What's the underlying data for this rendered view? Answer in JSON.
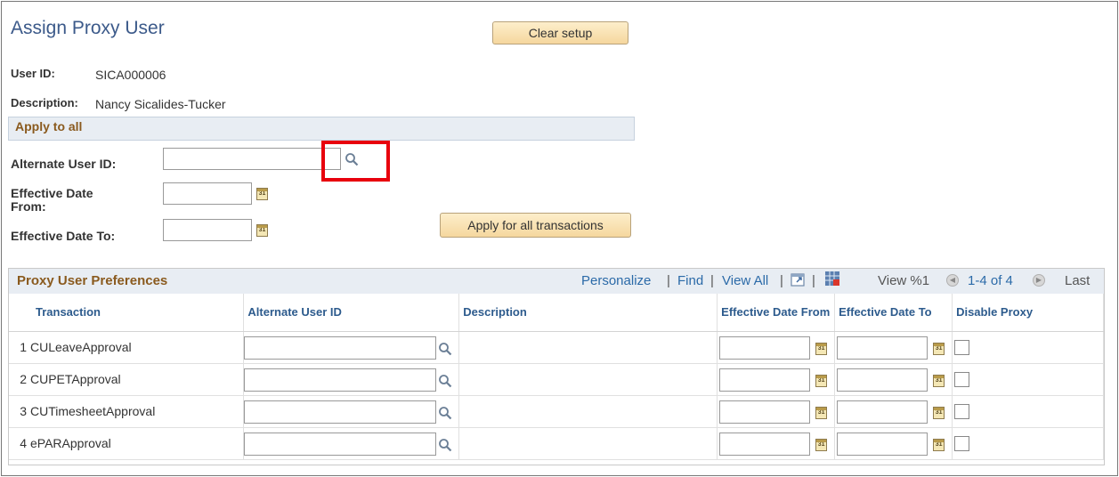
{
  "page": {
    "title": "Assign Proxy User",
    "clear_button": "Clear setup",
    "user_id_label": "User ID:",
    "user_id_value": "SICA000006",
    "description_label": "Description:",
    "description_value": "Nancy Sicalides-Tucker"
  },
  "apply_all": {
    "section_title": "Apply to all",
    "alternate_user_label": "Alternate User ID:",
    "effective_from_label": "Effective Date\nFrom:",
    "effective_to_label": "Effective Date To:",
    "apply_button": "Apply for all transactions"
  },
  "grid": {
    "title": "Proxy User Preferences",
    "personalize": "Personalize",
    "find": "Find",
    "view_all": "View All",
    "view_pct": "View %1",
    "range": "1-4 of 4",
    "last": "Last",
    "separator": "|",
    "columns": [
      "Transaction",
      "Alternate User ID",
      "Description",
      "Effective Date From",
      "Effective Date To",
      "Disable Proxy"
    ],
    "rows": [
      {
        "num": "1",
        "transaction": "CULeaveApproval"
      },
      {
        "num": "2",
        "transaction": "CUPETApproval"
      },
      {
        "num": "3",
        "transaction": "CUTimesheetApproval"
      },
      {
        "num": "4",
        "transaction": "ePARApproval"
      }
    ]
  },
  "icons": {
    "lookup": "magnifier-icon",
    "calendar": "calendar-icon",
    "new_window": "new-window-icon",
    "download": "download-grid-icon",
    "prev": "previous-arrow-icon",
    "next": "next-arrow-icon",
    "calendar_text": "31"
  },
  "colors": {
    "title": "#3c5a8a",
    "section_title": "#8a5a1e",
    "link": "#2b6aa8",
    "highlight": "#e8000d",
    "button_bg": "#f5d79e"
  }
}
